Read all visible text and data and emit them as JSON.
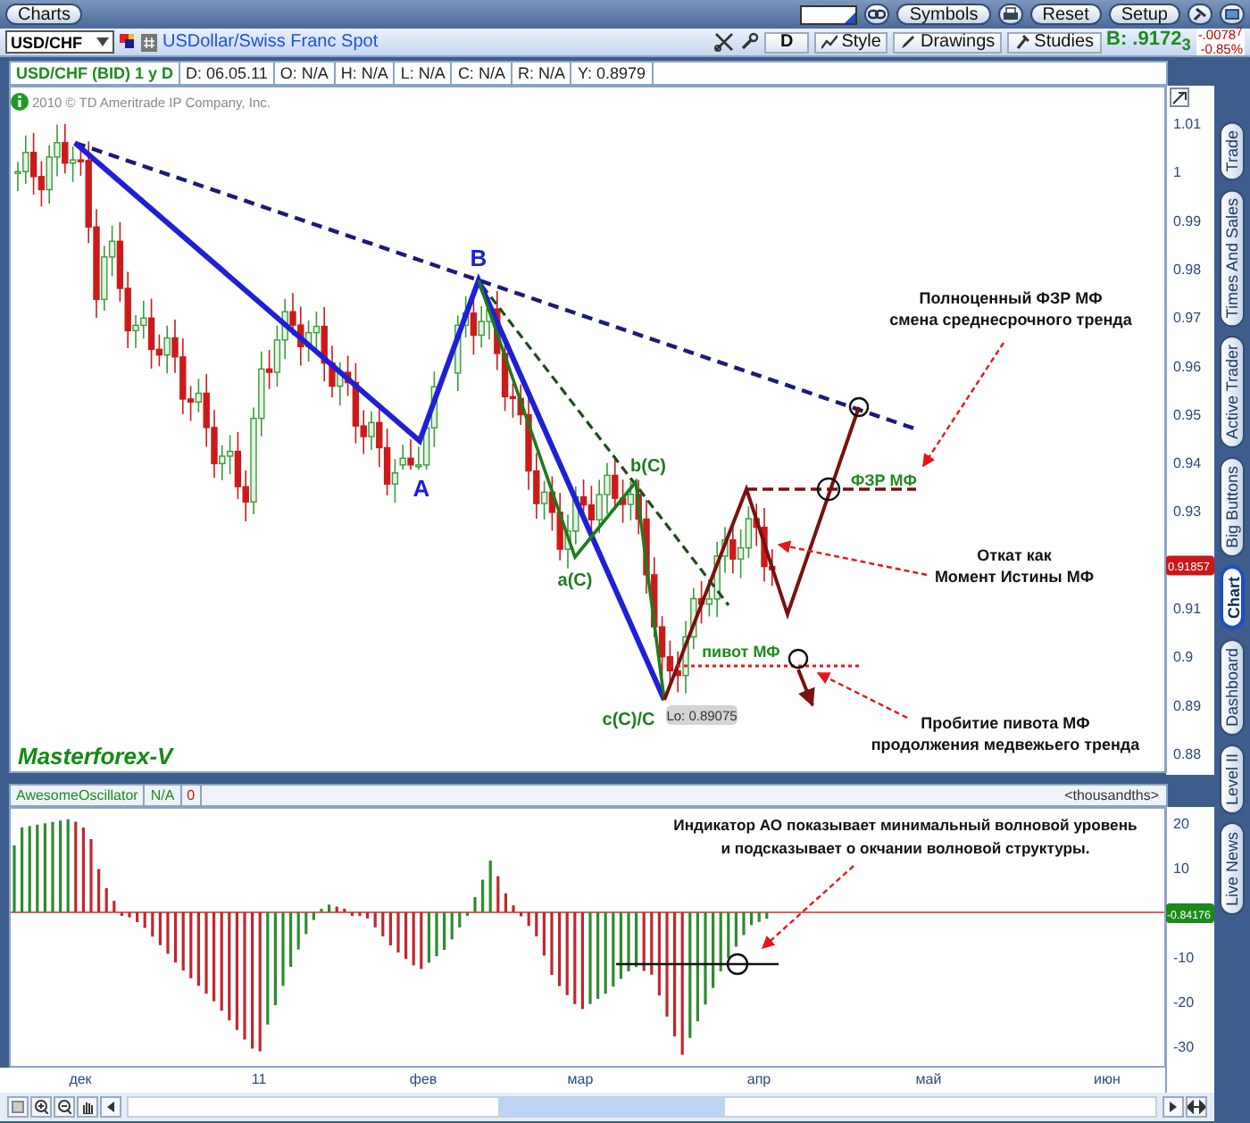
{
  "app_bar": {
    "title_button": "Charts",
    "buttons": [
      "Symbols",
      "Reset",
      "Setup"
    ]
  },
  "toolbar": {
    "symbol": "USD/CHF",
    "description": "USDollar/Swiss Franc Spot",
    "period": "D",
    "buttons": [
      "Style",
      "Drawings",
      "Studies"
    ],
    "bid": "B: .9172$_{3}$",
    "change": "-.0078$^{7}$",
    "change_percent": "-0.85%"
  },
  "info_row": [
    "USD/CHF (BID) 1 y D",
    "D: 06.05.11",
    "O: N/A",
    "H: N/A",
    "L: N/A",
    "C: N/A",
    "R: N/A",
    "Y: 0.8979"
  ],
  "price_chart": {
    "copyright": "2010 © TD Ameritrade IP Company, Inc.",
    "brand": "Masterforex-V",
    "y_ticks": [
      "1.01",
      "1",
      "0.99",
      "0.98",
      "0.97",
      "0.96",
      "0.95",
      "0.94",
      "0.93",
      "0.91",
      "0.9",
      "0.89",
      "0.88"
    ],
    "last_price": "0.91857",
    "low_label": "Lo: 0.89075",
    "wave_labels": [
      {
        "text": "A",
        "color": "#1f1fd6"
      },
      {
        "text": "B",
        "color": "#1f1fd6"
      },
      {
        "text": "a(C)",
        "color": "#1e7a1e"
      },
      {
        "text": "b(C)",
        "color": "#1e7a1e"
      },
      {
        "text": "c(C)/C",
        "color": "#1e7a1e"
      }
    ],
    "level_labels": [
      "ФЗР МФ",
      "пивот МФ"
    ],
    "notes": [
      {
        "lines": [
          "Полноценный ФЗР МФ",
          "смена среднесрочного тренда"
        ]
      },
      {
        "lines": [
          "Откат как",
          "Момент Истины МФ"
        ]
      },
      {
        "lines": [
          "Пробитие пивота МФ",
          "продолжения медвежьего тренда"
        ]
      }
    ]
  },
  "oscillator": {
    "name": "AwesomeOscillator",
    "value": "N/A",
    "zero": "0",
    "units": "<thousandths>",
    "note": [
      "Индикатор АО показывает минимальный волновой уровень",
      "и подсказывает о окчании волновой структуры."
    ],
    "y_ticks": [
      "20",
      "10",
      "-10",
      "-20",
      "-30"
    ],
    "last_value": "-0.84176"
  },
  "x_axis": [
    "дек",
    "11",
    "фев",
    "мар",
    "апр",
    "май",
    "июн"
  ],
  "side_tabs": [
    {
      "label": "Trade",
      "selected": false
    },
    {
      "label": "Times And Sales",
      "selected": false
    },
    {
      "label": "Active Trader",
      "selected": false
    },
    {
      "label": "Big Buttons",
      "selected": false
    },
    {
      "label": "Chart",
      "selected": true
    },
    {
      "label": "Dashboard",
      "selected": false
    },
    {
      "label": "Level II",
      "selected": false
    },
    {
      "label": "Live News",
      "selected": false
    }
  ]
}
